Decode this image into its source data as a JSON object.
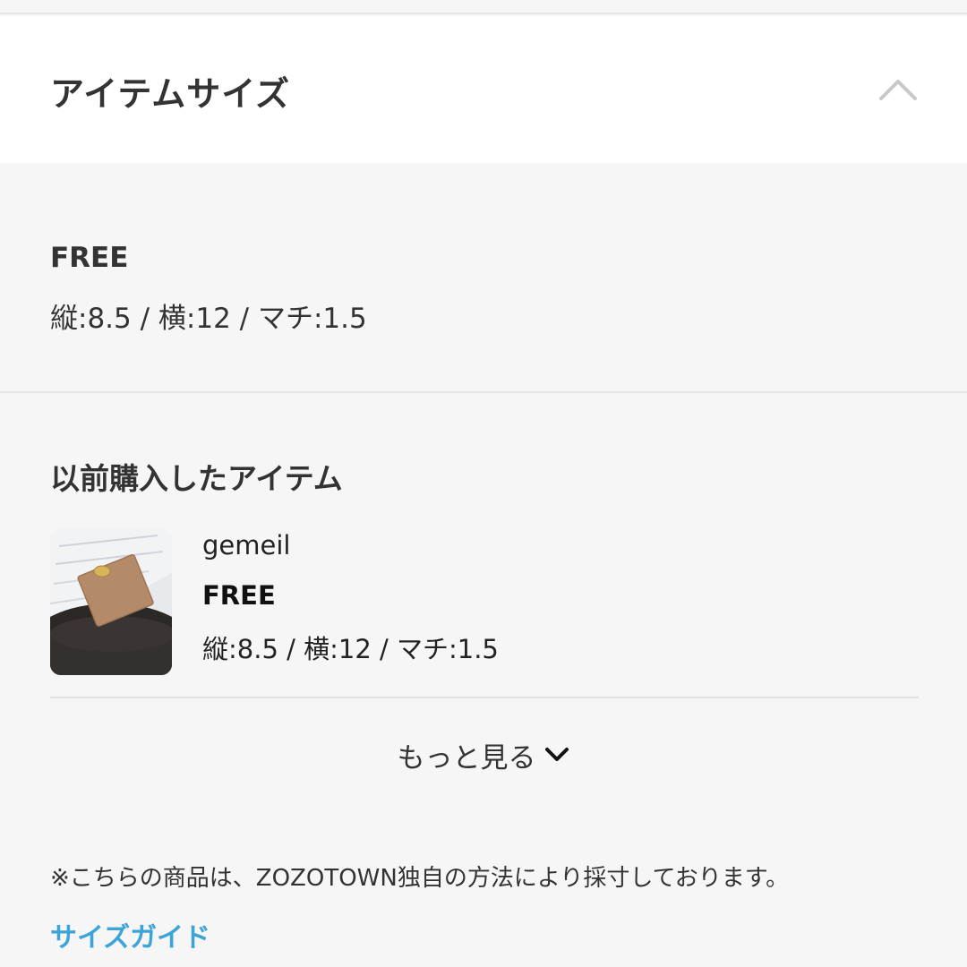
{
  "header": {
    "title": "アイテムサイズ"
  },
  "size": {
    "name": "FREE",
    "detail": "縦:8.5 / 横:12 / マチ:1.5"
  },
  "history": {
    "title": "以前購入したアイテム",
    "items": [
      {
        "brand": "gemeil",
        "size": "FREE",
        "detail": "縦:8.5 / 横:12 / マチ:1.5"
      }
    ],
    "more_label": "もっと見る"
  },
  "footer": {
    "note": "※こちらの商品は、ZOZOTOWN独自の方法により採寸しております。",
    "guide_link": "サイズガイド"
  },
  "colors": {
    "link": "#3ca4d9",
    "background": "#f6f6f6",
    "header_background": "#ffffff"
  }
}
